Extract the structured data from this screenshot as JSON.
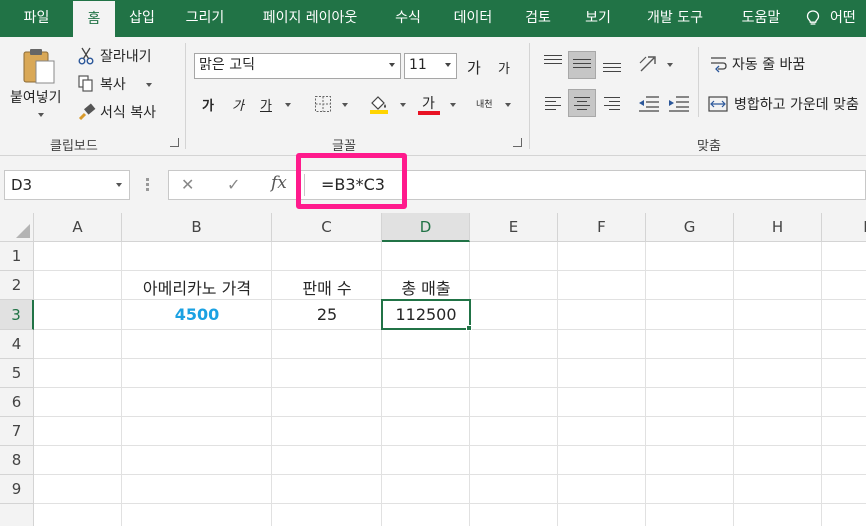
{
  "tabs": [
    "파일",
    "홈",
    "삽입",
    "그리기",
    "페이지 레이아웃",
    "수식",
    "데이터",
    "검토",
    "보기",
    "개발 도구",
    "도움말"
  ],
  "help_search": "어떤",
  "ribbon": {
    "clipboard": {
      "paste": "붙여넣기",
      "cut": "잘라내기",
      "copy": "복사",
      "format_painter": "서식 복사",
      "group_label": "클립보드"
    },
    "font": {
      "font_name": "맑은 고딕",
      "font_size": "11",
      "grow": "가",
      "shrink": "가",
      "bold": "가",
      "italic": "가",
      "underline": "가",
      "fill_icon_label": "",
      "font_color_label": "가",
      "phonetic": "내천",
      "group_label": "글꼴",
      "font_color": "#e81123",
      "fill_color": "#ffd400"
    },
    "alignment": {
      "wrap_text": "자동 줄 바꿈",
      "merge_center": "병합하고 가운데 맞춤",
      "group_label": "맞춤"
    }
  },
  "formula_bar": {
    "name_box": "D3",
    "cancel": "✕",
    "enter": "✓",
    "fx": "fx",
    "formula": "=B3*C3",
    "highlight_color": "#ff1a8c"
  },
  "grid": {
    "columns": [
      "A",
      "B",
      "C",
      "D",
      "E",
      "F",
      "G",
      "H",
      "I"
    ],
    "rows": [
      "1",
      "2",
      "3",
      "4",
      "5",
      "6",
      "7",
      "8",
      "9"
    ],
    "selected_column": "D",
    "selected_row": "3",
    "cells": {
      "B2": "아메리카노 가격",
      "C2": "판매 수",
      "D2": "총 매출",
      "B3": "4500",
      "C3": "25",
      "D3": "112500"
    },
    "accent_value_color": "#1ba1e2",
    "selection_color": "#217346"
  }
}
